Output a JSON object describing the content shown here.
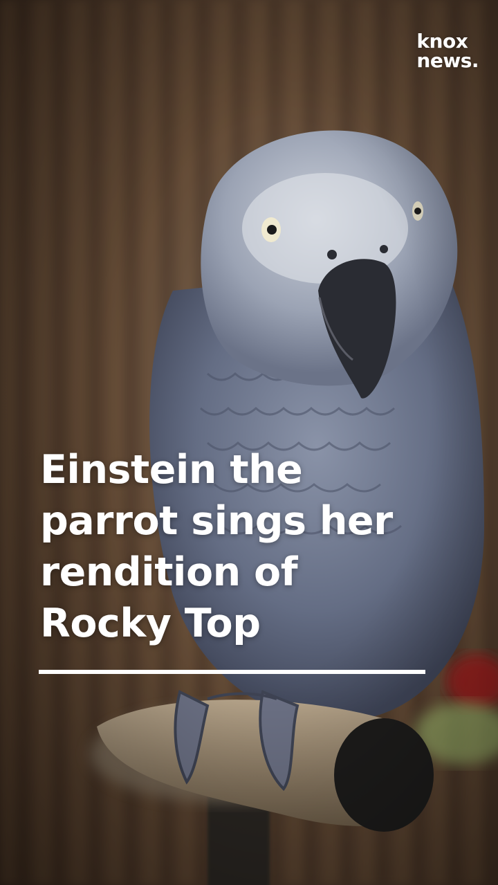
{
  "brand": {
    "logo_line_1": "knox",
    "logo_line_2": "news."
  },
  "headline": {
    "lines": [
      "Einstein the",
      "parrot sings her",
      "rendition of",
      "Rocky Top"
    ]
  },
  "colors": {
    "text": "#ffffff",
    "rule": "#ffffff",
    "parrot_feathers": "#6f7a90",
    "background_wood": "#5a4433"
  }
}
